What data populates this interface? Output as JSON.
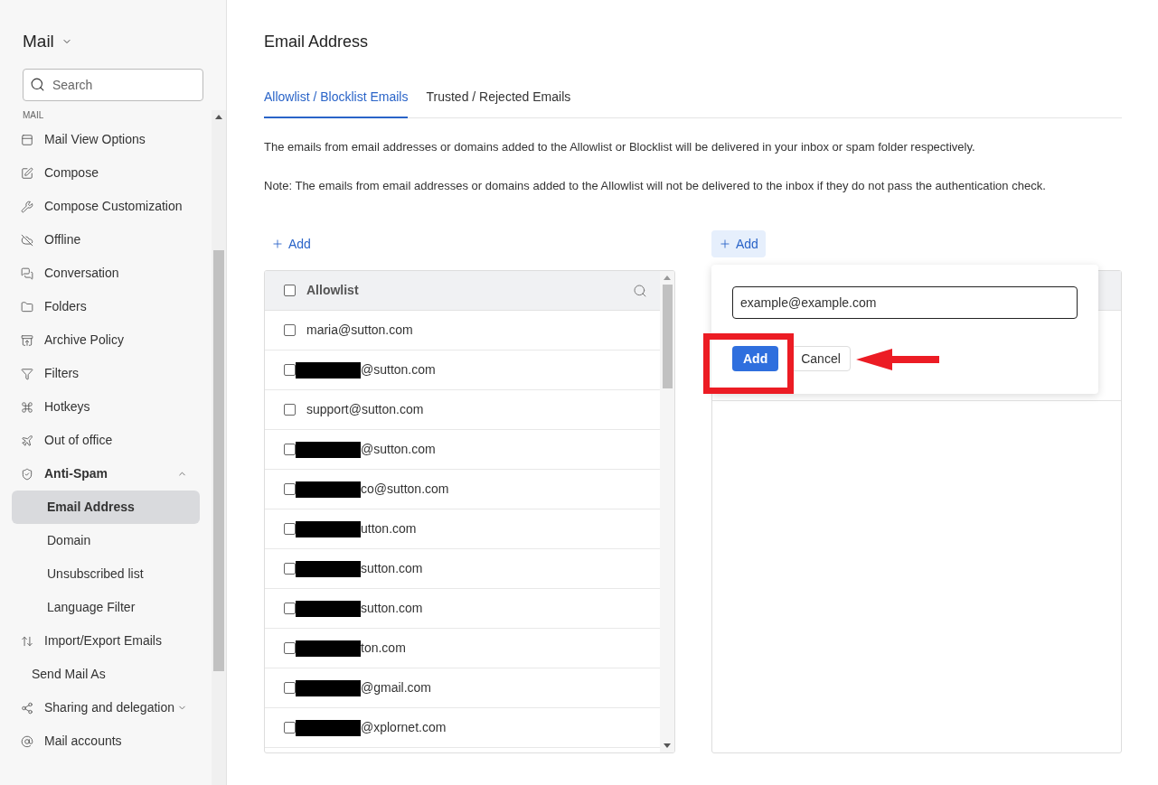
{
  "sidebar": {
    "title": "Mail",
    "search": {
      "placeholder": "Search"
    },
    "section": "MAIL",
    "items": [
      {
        "kind": "item",
        "label": "Mail View Options",
        "selected": false
      },
      {
        "kind": "item",
        "label": "Compose",
        "selected": false
      },
      {
        "kind": "item",
        "label": "Compose Customization",
        "selected": false
      },
      {
        "kind": "item",
        "label": "Offline",
        "selected": false
      },
      {
        "kind": "item",
        "label": "Conversation",
        "selected": false
      },
      {
        "kind": "item",
        "label": "Folders",
        "selected": false
      },
      {
        "kind": "item",
        "label": "Archive Policy",
        "selected": false
      },
      {
        "kind": "item",
        "label": "Filters",
        "selected": false
      },
      {
        "kind": "item",
        "label": "Hotkeys",
        "selected": false
      },
      {
        "kind": "item",
        "label": "Out of office",
        "selected": false
      },
      {
        "kind": "group",
        "label": "Anti-Spam",
        "expanded": true,
        "children": [
          {
            "label": "Email Address",
            "selected": true
          },
          {
            "label": "Domain",
            "selected": false
          },
          {
            "label": "Unsubscribed list",
            "selected": false
          },
          {
            "label": "Language Filter",
            "selected": false
          }
        ]
      },
      {
        "kind": "item",
        "label": "Import/Export Emails",
        "selected": false
      },
      {
        "kind": "plain",
        "label": "Send Mail As",
        "selected": false
      },
      {
        "kind": "group",
        "label": "Sharing and delegation",
        "expanded": false
      },
      {
        "kind": "item",
        "label": "Mail accounts",
        "selected": false
      }
    ]
  },
  "main": {
    "title": "Email Address",
    "tabs": [
      {
        "label": "Allowlist / Blocklist Emails",
        "selected": true
      },
      {
        "label": "Trusted / Rejected Emails",
        "selected": false
      }
    ],
    "notes": [
      "The emails from email addresses or domains added to the Allowlist or Blocklist will be delivered in your inbox or spam folder respectively.",
      "Note: The emails from email addresses or domains added to the Allowlist will not be delivered to the inbox if they do not pass the authentication check."
    ],
    "allowlist": {
      "add_label": "Add",
      "header": "Allowlist",
      "header_checked": false,
      "rows": [
        {
          "text": "maria@sutton.com",
          "redacted": false,
          "checked": false
        },
        {
          "text": "@sutton.com",
          "redacted": true,
          "checked": false
        },
        {
          "text": "support@sutton.com",
          "redacted": false,
          "checked": false
        },
        {
          "text": "@sutton.com",
          "redacted": true,
          "checked": false
        },
        {
          "text": "co@sutton.com",
          "redacted": true,
          "checked": false
        },
        {
          "text": "utton.com",
          "redacted": true,
          "checked": false
        },
        {
          "text": "sutton.com",
          "redacted": true,
          "checked": false
        },
        {
          "text": "sutton.com",
          "redacted": true,
          "checked": false
        },
        {
          "text": "ton.com",
          "redacted": true,
          "checked": false
        },
        {
          "text": "@gmail.com",
          "redacted": true,
          "checked": false
        },
        {
          "text": "@xplornet.com",
          "redacted": true,
          "checked": false
        }
      ]
    },
    "blocklist": {
      "add_label": "Add",
      "add_active": true,
      "popover": {
        "value": "example@example.com",
        "confirm": "Add",
        "cancel": "Cancel"
      }
    }
  }
}
